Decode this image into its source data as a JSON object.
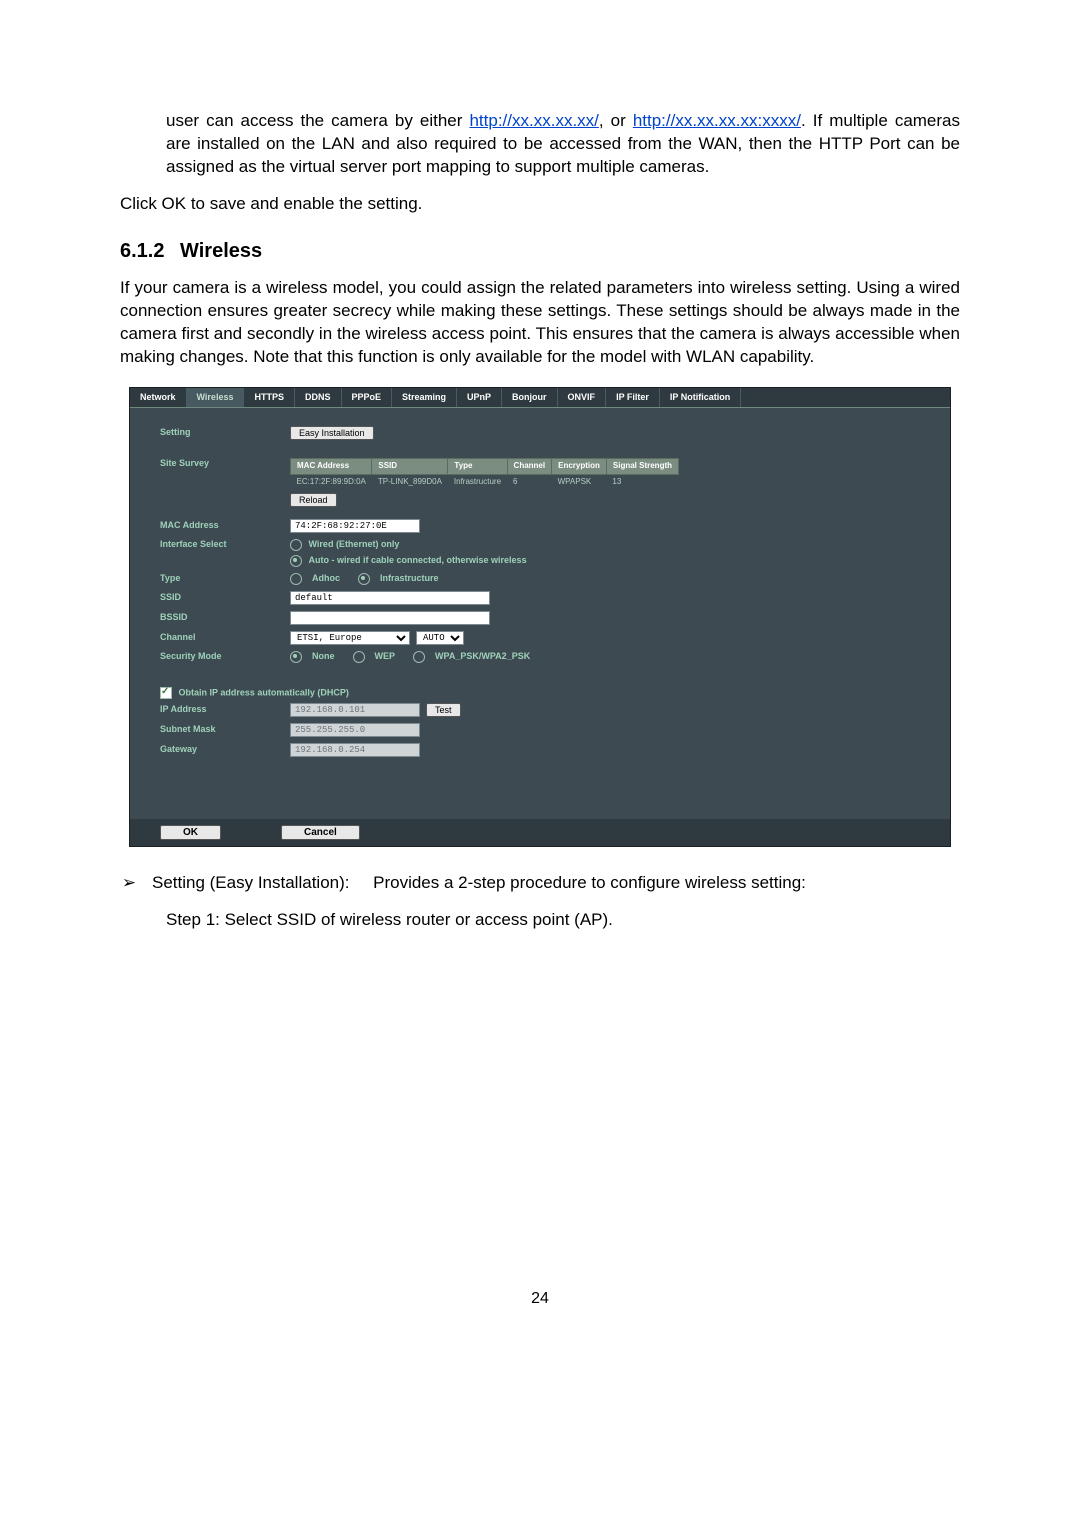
{
  "intro_before_link": "user can access the camera by either ",
  "link1": "http://xx.xx.xx.xx/",
  "intro_mid": ", or ",
  "link2": "http://xx.xx.xx.xx:xxxx/",
  "intro_after_link": ". If multiple cameras are installed on the LAN and also required to be accessed from the WAN, then the HTTP Port  can be assigned as the virtual server port mapping to support multiple cameras.",
  "save_line": "Click OK to save and enable the setting.",
  "section_num": "6.1.2",
  "section_title": "Wireless",
  "wireless_para": "If your camera is a wireless model, you could assign the related parameters into wireless setting. Using a wired connection ensures greater secrecy while making these settings. These settings should be always made in the camera first and secondly in the wireless access point. This ensures that the camera is always accessible when making changes. Note that this function is only available for the model with WLAN capability.",
  "tabs": [
    "Network",
    "Wireless",
    "HTTPS",
    "DDNS",
    "PPPoE",
    "Streaming",
    "UPnP",
    "Bonjour",
    "ONVIF",
    "IP Filter",
    "IP Notification"
  ],
  "selected_tab": "Wireless",
  "labels": {
    "setting": "Setting",
    "site_survey": "Site Survey",
    "mac_address": "MAC Address",
    "interface_select": "Interface Select",
    "type": "Type",
    "ssid": "SSID",
    "bssid": "BSSID",
    "channel": "Channel",
    "security_mode": "Security Mode",
    "dhcp": "Obtain IP address automatically (DHCP)",
    "ip_address": "IP Address",
    "subnet_mask": "Subnet Mask",
    "gateway": "Gateway"
  },
  "buttons": {
    "easy_install": "Easy Installation",
    "reload": "Reload",
    "test": "Test",
    "ok": "OK",
    "cancel": "Cancel"
  },
  "survey_headers": [
    "MAC Address",
    "SSID",
    "Type",
    "Channel",
    "Encryption",
    "Signal Strength"
  ],
  "survey_row": [
    "EC:17:2F:89:9D:0A",
    "TP-LINK_899D0A",
    "Infrastructure",
    "6",
    "WPAPSK",
    "13"
  ],
  "mac_value": "74:2F:68:92:27:0E",
  "iface_wired": "Wired (Ethernet) only",
  "iface_auto": "Auto - wired if cable connected, otherwise wireless",
  "type_adhoc": "Adhoc",
  "type_infra": "Infrastructure",
  "ssid_value": "default",
  "bssid_value": "",
  "channel_region": "ETSI, Europe",
  "channel_auto": "AUTO",
  "sec_none": "None",
  "sec_wep": "WEP",
  "sec_wpa": "WPA_PSK/WPA2_PSK",
  "ip_value": "192.168.0.101",
  "mask_value": "255.255.255.0",
  "gw_value": "192.168.0.254",
  "bullet_title": "Setting (Easy Installation):",
  "bullet_text": "Provides a 2-step procedure to configure wireless setting:",
  "step1": "Step 1:  Select SSID of wireless router or access point (AP).",
  "page_number": "24"
}
